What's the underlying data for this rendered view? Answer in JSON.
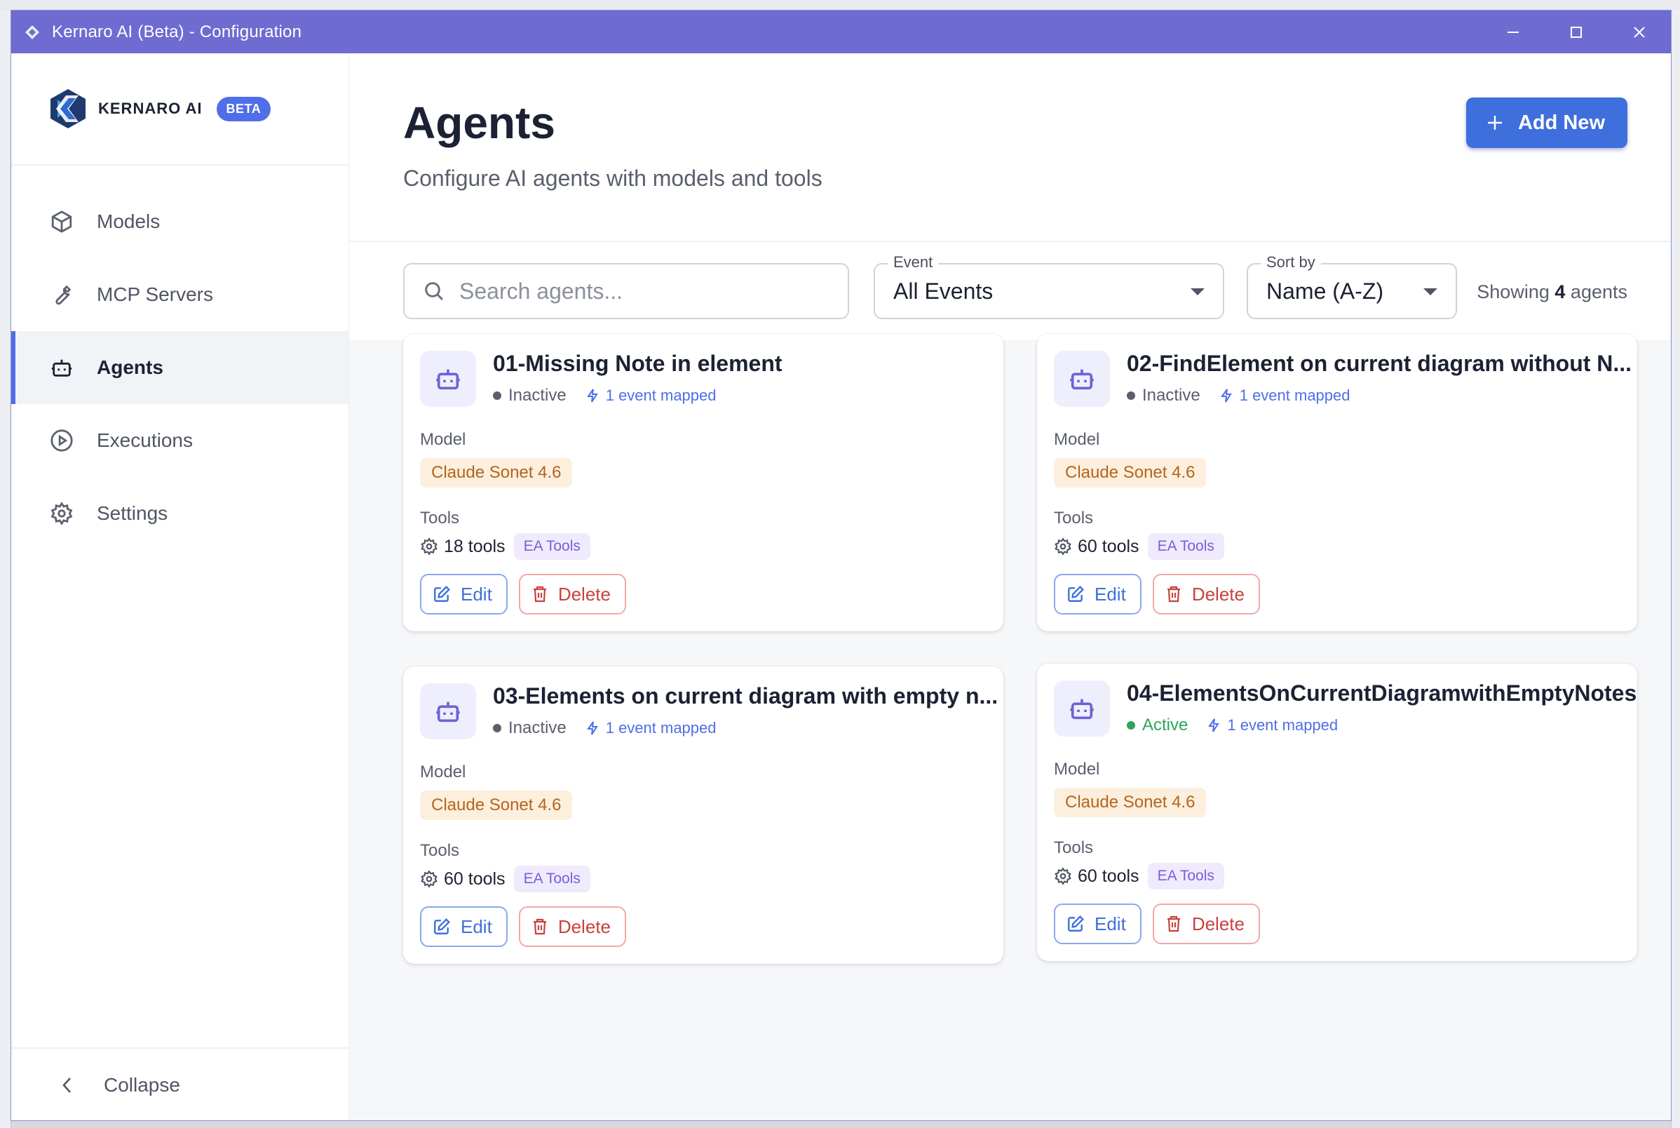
{
  "window": {
    "title": "Kernaro AI (Beta) - Configuration"
  },
  "brand": {
    "name": "KERNARO AI",
    "badge": "BETA"
  },
  "sidebar": {
    "items": [
      {
        "label": "Models",
        "icon": "cube-icon",
        "active": false
      },
      {
        "label": "MCP Servers",
        "icon": "wrench-icon",
        "active": false
      },
      {
        "label": "Agents",
        "icon": "robot-icon",
        "active": true
      },
      {
        "label": "Executions",
        "icon": "play-circle-icon",
        "active": false
      },
      {
        "label": "Settings",
        "icon": "gear-icon",
        "active": false
      }
    ],
    "collapse_label": "Collapse"
  },
  "header": {
    "title": "Agents",
    "subtitle": "Configure AI agents with models and tools",
    "add_label": "Add New"
  },
  "filters": {
    "search_placeholder": "Search agents...",
    "event_label": "Event",
    "event_value": "All Events",
    "sort_label": "Sort by",
    "sort_value": "Name (A-Z)",
    "showing_prefix": "Showing",
    "showing_count": "4",
    "showing_suffix": "agents"
  },
  "labels": {
    "model": "Model",
    "tools": "Tools",
    "edit": "Edit",
    "delete": "Delete"
  },
  "agents": [
    {
      "name": "01-Missing Note in element",
      "status": "Inactive",
      "events": "1 event mapped",
      "model": "Claude Sonet 4.6",
      "tools": "18 tools",
      "tool_group": "EA Tools"
    },
    {
      "name": "02-FindElement on current diagram without N...",
      "status": "Inactive",
      "events": "1 event mapped",
      "model": "Claude Sonet 4.6",
      "tools": "60 tools",
      "tool_group": "EA Tools"
    },
    {
      "name": "03-Elements on current diagram with empty n...",
      "status": "Inactive",
      "events": "1 event mapped",
      "model": "Claude Sonet 4.6",
      "tools": "60 tools",
      "tool_group": "EA Tools"
    },
    {
      "name": "04-ElementsOnCurrentDiagramwithEmptyNotes",
      "status": "Active",
      "events": "1 event mapped",
      "model": "Claude Sonet 4.6",
      "tools": "60 tools",
      "tool_group": "EA Tools"
    }
  ],
  "colors": {
    "titlebar": "#6e6bd1",
    "accent": "#3f6fdc",
    "active_status": "#2aa55a",
    "delete": "#c7423f"
  }
}
